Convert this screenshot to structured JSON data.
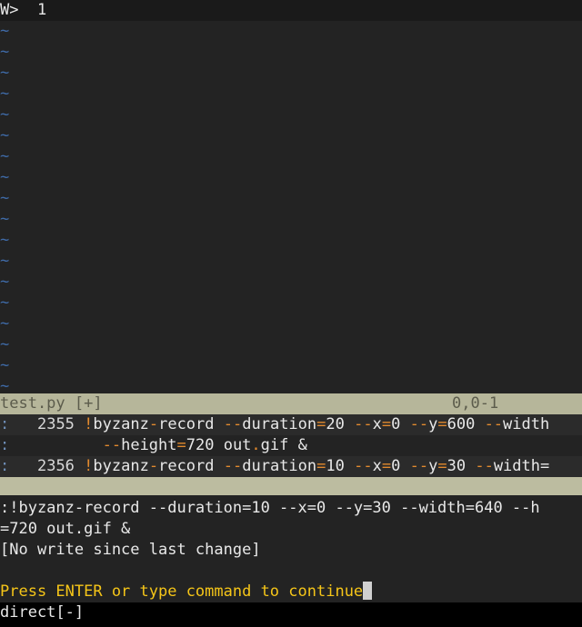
{
  "tab_bar": {
    "prompt": "W>",
    "tab_number": "1"
  },
  "buffer": {
    "empty_marker": "~"
  },
  "statusline": {
    "filename": "test.py [+]",
    "position": "0,0-1"
  },
  "history": {
    "entries": [
      {
        "marker": ":",
        "number": "2355",
        "bang": "!",
        "cmd": "byzanz",
        "d1": "-",
        "cmd2": "record",
        "a1d": "--",
        "a1": "duration",
        "a1eq": "=",
        "a1v": "20",
        "a2d": "--",
        "a2": "x",
        "a2eq": "=",
        "a2v": "0",
        "a3d": "--",
        "a3": "y",
        "a3eq": "=",
        "a3v": "600",
        "a4d": "--",
        "a4": "width"
      },
      {
        "marker": ":",
        "cont_d": "--",
        "cont_a": "height",
        "cont_eq": "=",
        "cont_v": "720 out",
        "cont_dot": ".",
        "cont_rest": "gif &"
      },
      {
        "marker": ":",
        "number": "2356",
        "bang": "!",
        "cmd": "byzanz",
        "d1": "-",
        "cmd2": "record",
        "a1d": "--",
        "a1": "duration",
        "a1eq": "=",
        "a1v": "10",
        "a2d": "--",
        "a2": "x",
        "a2eq": "=",
        "a2v": "0",
        "a3d": "--",
        "a3": "y",
        "a3eq": "=",
        "a3v": "30",
        "a4d": "--",
        "a4": "width="
      }
    ]
  },
  "message": {
    "line1": ":!byzanz-record --duration=10 --x=0 --y=30 --width=640 --h",
    "line2": "=720 out.gif &",
    "line3": "[No write since last change]",
    "prompt": "Press ENTER or type command to continue"
  },
  "bottom_bar": {
    "text": "direct[-]"
  },
  "colors": {
    "background": "#232323",
    "statusline": "#b6b69a",
    "tilde": "#3f6ba8",
    "accent": "#e28a2e",
    "prompt": "#f5c518"
  }
}
